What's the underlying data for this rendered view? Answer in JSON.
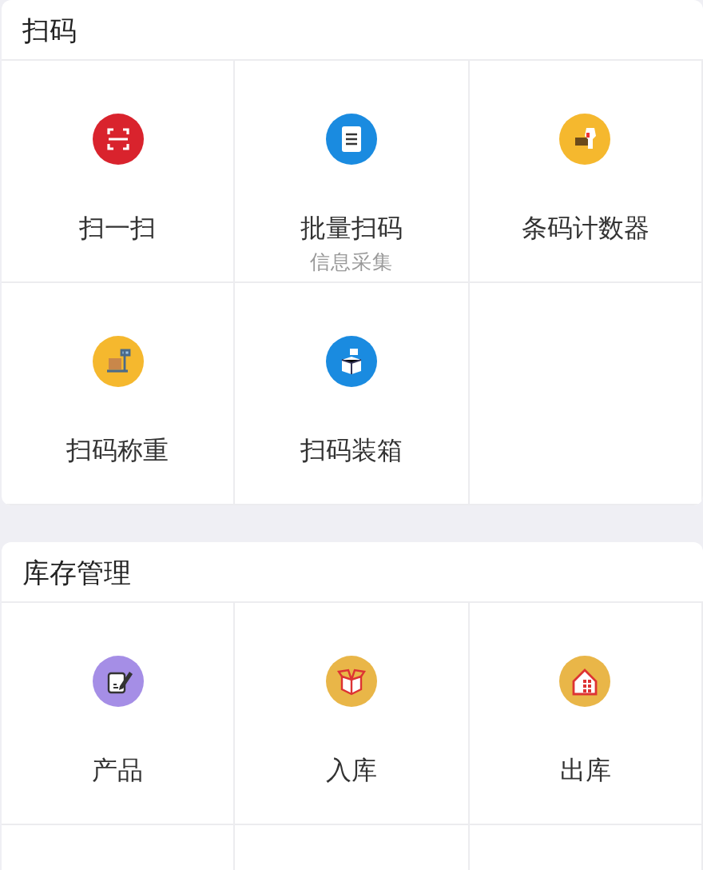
{
  "sections": [
    {
      "title": "扫码",
      "items": [
        {
          "label": "扫一扫",
          "kind": "scan",
          "color": "#d9232d"
        },
        {
          "label": "批量扫码",
          "sublabel": "信息采集",
          "kind": "list",
          "color": "#1a8be0"
        },
        {
          "label": "条码计数器",
          "kind": "scanner",
          "color": "#f5b82e"
        },
        {
          "label": "扫码称重",
          "kind": "scale",
          "color": "#f5b82e"
        },
        {
          "label": "扫码装箱",
          "kind": "packing",
          "color": "#1a8be0"
        }
      ]
    },
    {
      "title": "库存管理",
      "items": [
        {
          "label": "产品",
          "kind": "edit",
          "color": "#a58ee6"
        },
        {
          "label": "入库",
          "kind": "box",
          "color": "#e9b648"
        },
        {
          "label": "出库",
          "kind": "warehouse",
          "color": "#e9b648"
        }
      ]
    }
  ]
}
